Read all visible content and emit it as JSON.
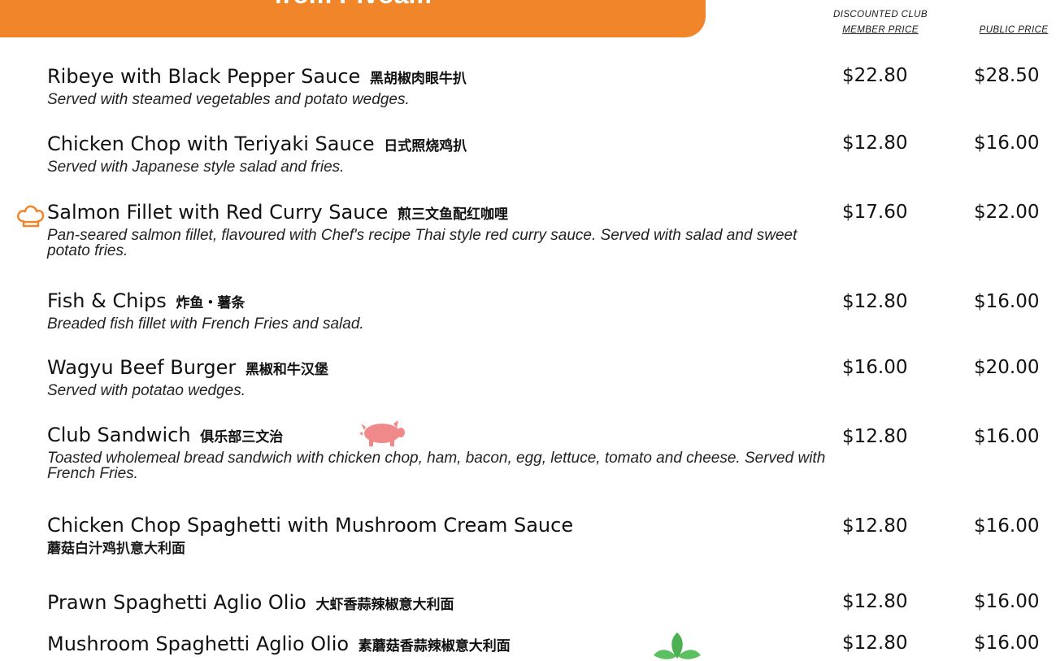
{
  "header": {
    "banner_text": "from Pivoam",
    "member_price_line1": "Discounted Club",
    "member_price_line2": "Member Price",
    "public_price": "Public Price"
  },
  "items": [
    {
      "name": "Ribeye with Black Pepper Sauce",
      "cn": "黑胡椒肉眼牛扒",
      "desc": "Served with steamed vegetables and potato wedges.",
      "member_price": "$22.80",
      "public_price": "$28.50"
    },
    {
      "name": "Chicken Chop with Teriyaki Sauce",
      "cn": "日式照烧鸡扒",
      "desc": "Served with Japanese style salad and fries.",
      "member_price": "$12.80",
      "public_price": "$16.00"
    },
    {
      "name": "Salmon Fillet with Red Curry Sauce",
      "cn": "煎三文鱼配红咖哩",
      "desc": "Pan-seared salmon fillet, flavoured with Chef's recipe Thai style red curry sauce. Served with salad and sweet potato fries.",
      "member_price": "$17.60",
      "public_price": "$22.00"
    },
    {
      "name": "Fish & Chips",
      "cn": "炸鱼・薯条",
      "desc": "Breaded fish fillet with French Fries and salad.",
      "member_price": "$12.80",
      "public_price": "$16.00"
    },
    {
      "name": "Wagyu Beef Burger",
      "cn": "黑椒和牛汉堡",
      "desc": "Served with potatao wedges.",
      "member_price": "$16.00",
      "public_price": "$20.00"
    },
    {
      "name": "Club Sandwich",
      "cn": "俱乐部三文治",
      "desc": "Toasted wholemeal bread sandwich with chicken chop, ham, bacon, egg, lettuce, tomato and cheese. Served with French Fries.",
      "member_price": "$12.80",
      "public_price": "$16.00"
    },
    {
      "name": "Chicken Chop Spaghetti with Mushroom Cream Sauce",
      "cn": "蘑菇白汁鸡扒意大利面",
      "desc": "",
      "member_price": "$12.80",
      "public_price": "$16.00"
    },
    {
      "name": "Prawn Spaghetti Aglio Olio",
      "cn": "大虾香蒜辣椒意大利面",
      "desc": "",
      "member_price": "$12.80",
      "public_price": "$16.00"
    },
    {
      "name": "Mushroom Spaghetti Aglio Olio",
      "cn": "素蘑菇香蒜辣椒意大利面",
      "desc": "",
      "member_price": "$12.80",
      "public_price": "$16.00"
    }
  ],
  "icons": {
    "chef": "chef-hat-icon",
    "pork": "pig-icon",
    "vegetarian": "leaf-icon"
  },
  "colors": {
    "banner": "#f0852a",
    "chef_icon": "#f0852a",
    "pig_icon": "#f08a8a",
    "leaf_icon": "#4caf50"
  }
}
